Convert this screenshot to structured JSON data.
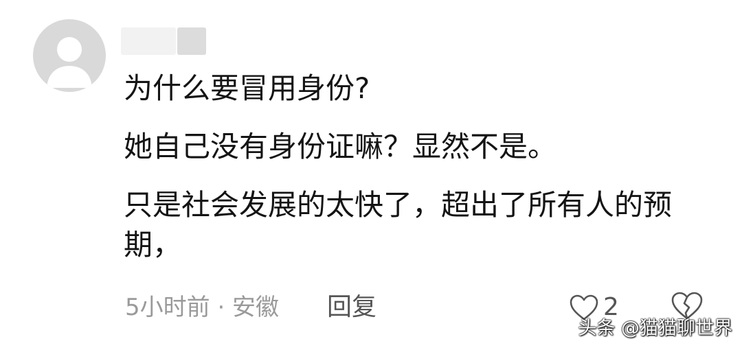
{
  "comment": {
    "lines": [
      "为什么要冒用身份?",
      "她自己没有身份证嘛？显然不是。",
      "只是社会发展的太快了，超出了所有人的预期，"
    ],
    "time_location": "5小时前 · 安徽",
    "reply_label": "回复",
    "like_count": "2",
    "like_icon": "heart-outline-icon",
    "dislike_icon": "broken-heart-icon"
  },
  "watermark": "头条 @猫猫聊世界",
  "colors": {
    "text": "#141414",
    "meta": "#9a9a9a",
    "action": "#555555",
    "avatar_bg": "#d9d9d9"
  }
}
